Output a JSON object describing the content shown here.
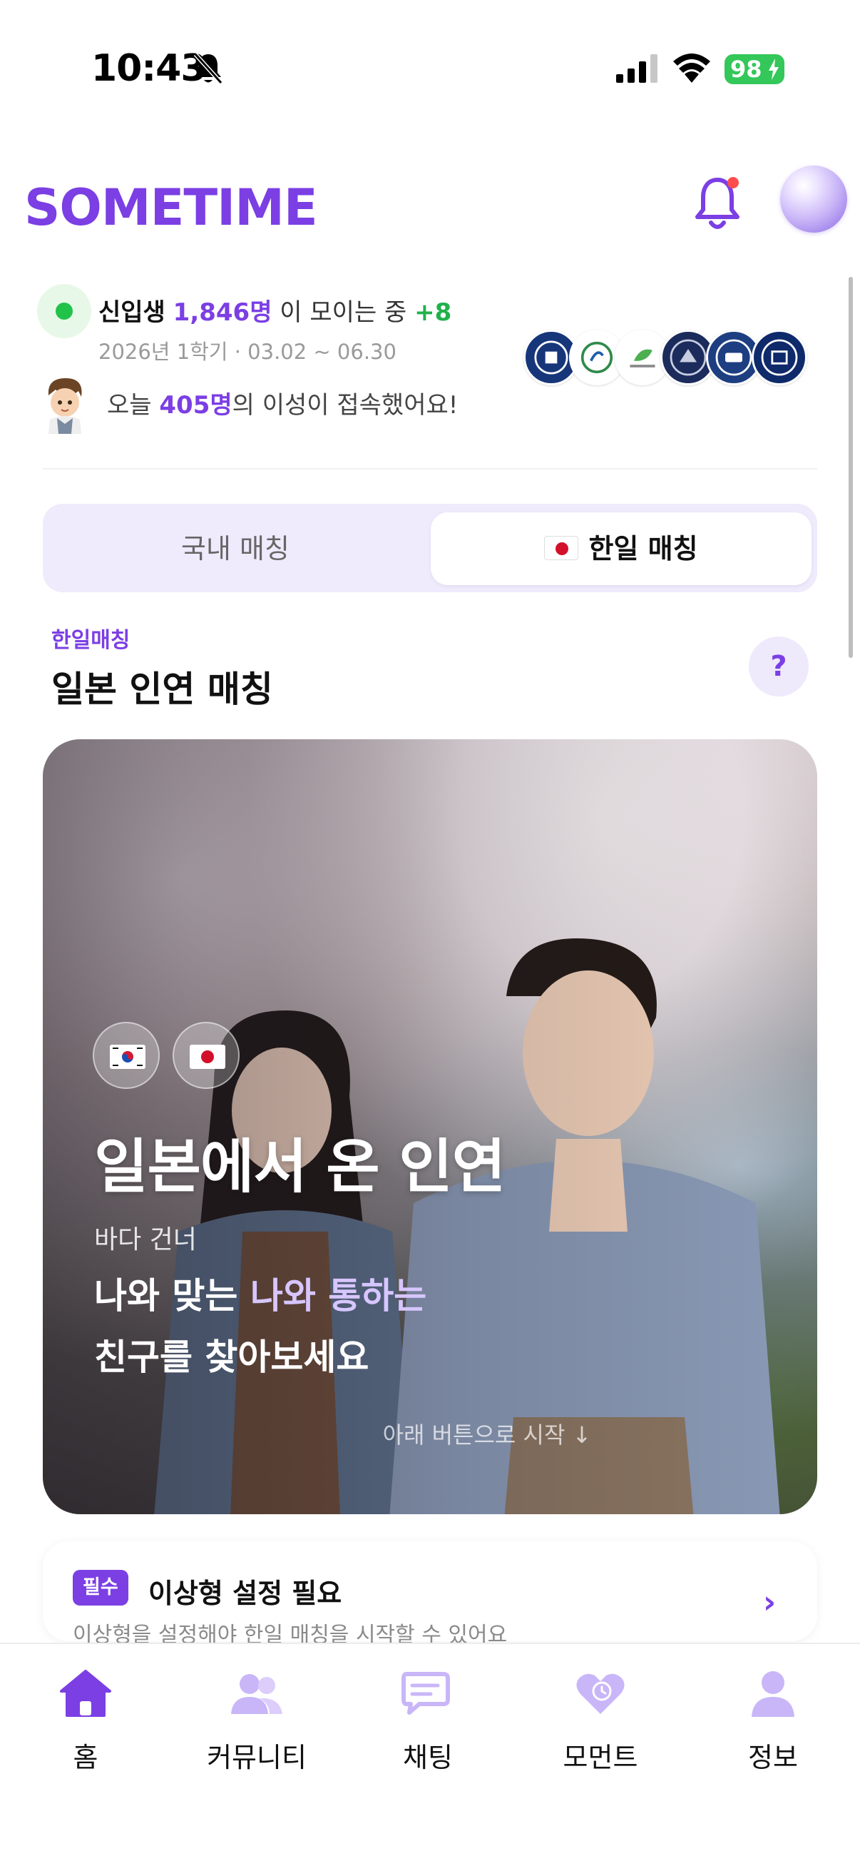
{
  "status_bar": {
    "time": "10:43",
    "battery": "98"
  },
  "header": {
    "logo": "SOMETIME"
  },
  "stats": {
    "label_freshmen": "신입생",
    "count": "1,846명",
    "gathering_text": "이 모이는 중",
    "delta": "+8",
    "semester": "2026년 1학기 · 03.02 ~ 06.30",
    "today_prefix": "오늘",
    "today_count": "405명",
    "today_suffix": "의 이성이 접속했어요!"
  },
  "tabs": {
    "domestic": "국내 매칭",
    "korea_japan": "한일 매칭"
  },
  "section": {
    "eyebrow": "한일매칭",
    "title": "일본 인연 매칭",
    "help": "?"
  },
  "hero": {
    "title": "일본에서 온 인연",
    "small": "바다 건너",
    "line1_a": "나와 맞는",
    "line1_b": "나와 통하는",
    "line2": "친구를 찾아보세요",
    "hint": "아래 버튼으로 시작 ↓"
  },
  "requirement": {
    "badge": "필수",
    "title": "이상형 설정 필요",
    "subtitle": "이상형을 설정해야 한일 매칭을 시작할 수 있어요",
    "chevron": "›"
  },
  "nav": [
    {
      "label": "홈",
      "icon": "home-icon",
      "active": true
    },
    {
      "label": "커뮤니티",
      "icon": "community-icon"
    },
    {
      "label": "채팅",
      "icon": "chat-icon"
    },
    {
      "label": "모먼트",
      "icon": "moment-heart-icon"
    },
    {
      "label": "정보",
      "icon": "profile-icon"
    }
  ],
  "colors": {
    "brand": "#7b3fe4",
    "brand_light": "#c9b6f8",
    "live": "#22c24a",
    "delta": "#22b14c"
  }
}
